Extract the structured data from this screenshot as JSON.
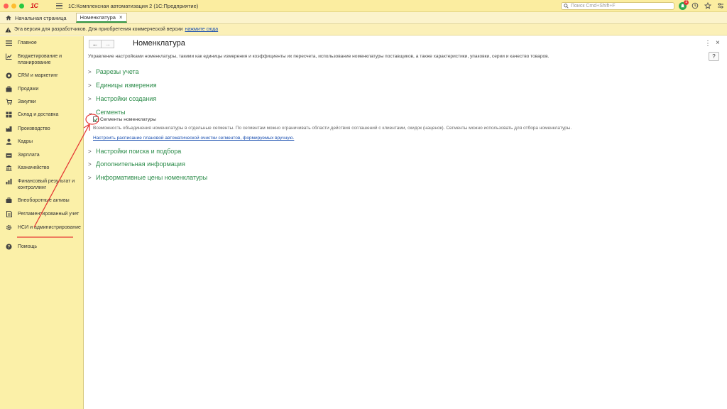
{
  "titlebar": {
    "logo_text": "1С",
    "app_title": "1С:Комплексная автоматизация 2  (1С:Предприятие)",
    "search_placeholder": "Поиск Cmd+Shift+F",
    "notification_count": "1"
  },
  "tabs": {
    "home_label": "Начальная страница",
    "active_label": "Номенклатура"
  },
  "infobar": {
    "text": "Эта версия для разработчиков. Для приобретения коммерческой версии",
    "link": "нажмите сюда"
  },
  "sidebar": {
    "items": [
      {
        "label": "Главное",
        "icon": "menu-lines-icon"
      },
      {
        "label": "Бюджетирование и планирование",
        "icon": "chart-icon"
      },
      {
        "label": "CRM и маркетинг",
        "icon": "crm-icon"
      },
      {
        "label": "Продажи",
        "icon": "bag-icon"
      },
      {
        "label": "Закупки",
        "icon": "cart-icon"
      },
      {
        "label": "Склад и доставка",
        "icon": "warehouse-icon"
      },
      {
        "label": "Производство",
        "icon": "factory-icon"
      },
      {
        "label": "Кадры",
        "icon": "person-icon"
      },
      {
        "label": "Зарплата",
        "icon": "money-icon"
      },
      {
        "label": "Казначейство",
        "icon": "treasury-icon"
      },
      {
        "label": "Финансовый результат и контроллинг",
        "icon": "finance-icon"
      },
      {
        "label": "Внеоборотные активы",
        "icon": "assets-icon"
      },
      {
        "label": "Регламентированный учет",
        "icon": "document-icon"
      },
      {
        "label": "НСИ и администрирование",
        "icon": "gear-icon"
      },
      {
        "label": "Помощь",
        "icon": "help-icon"
      }
    ]
  },
  "main": {
    "title": "Номенклатура",
    "help_label": "?",
    "description": "Управление настройками номенклатуры, такими как единицы измерения и коэффициенты их пересчета, использование номенклатуры поставщиков, а также характеристики, упаковки, серии и качество товаров.",
    "sections": {
      "s1": "Разрезы учета",
      "s2": "Единицы измерения",
      "s3": "Настройки создания",
      "s4": "Сегменты",
      "s5": "Настройки поиска и подбора",
      "s6": "Дополнительная информация",
      "s7": "Информативные цены номенклатуры"
    },
    "segments": {
      "checkbox_label": "Сегменты номенклатуры",
      "checked": true,
      "description": "Возможность объединения номенклатуры в отдельные сегменты. По сегментам можно ограничивать области действия соглашений с клиентами, скидок (наценок). Сегменты можно использовать для отбора номенклатуры.",
      "link": "Настроить расписание плановой автоматической очистки сегментов, формируемых вручную."
    }
  },
  "colors": {
    "accent_green": "#2c8c4a",
    "sidebar_bg": "#fbf0a8",
    "annotation_red": "#e53935",
    "link_blue": "#1a4fb0"
  }
}
